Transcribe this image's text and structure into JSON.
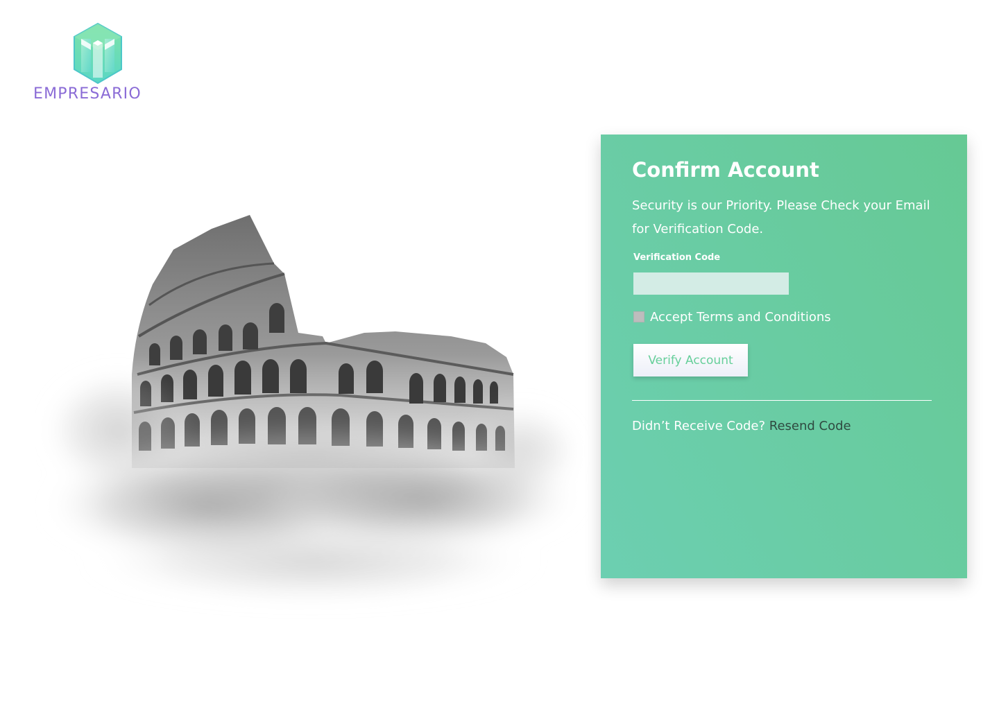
{
  "brand": {
    "name": "EMPRESARIO",
    "logo_icon": "hexagon-building-icon",
    "primary_color": "#8a6bd6",
    "accent_color": "#6ccfb1"
  },
  "illustration": {
    "icon": "colosseum-in-clouds-image"
  },
  "card": {
    "title": "Confirm Account",
    "subtitle": "Security is our Priority. Please Check your Email for Verification Code.",
    "verification_label": "Verification Code",
    "verification_value": "",
    "verification_placeholder": "",
    "terms_label": "Accept Terms and Conditions",
    "terms_checked": false,
    "verify_button_label": "Verify Account",
    "resend_prompt": "Didn’t Receive Code?",
    "resend_link_label": "Resend Code",
    "gradient_start": "#6ccfb1",
    "gradient_end": "#66c994"
  }
}
